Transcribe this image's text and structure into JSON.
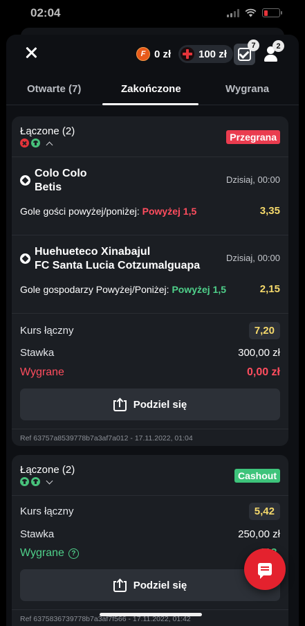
{
  "status_bar": {
    "time": "02:04"
  },
  "header": {
    "coins_value": "0 zł",
    "coin_letter": "F",
    "bonus_value": "100 zł",
    "betslip_count": "7",
    "notifications_count": "2"
  },
  "tabs": [
    {
      "label": "Otwarte (7)"
    },
    {
      "label": "Zakończone"
    },
    {
      "label": "Wygrana"
    }
  ],
  "cards": [
    {
      "title": "Łączone (2)",
      "status": "Przegrana",
      "selections": [
        {
          "home": "Colo Colo",
          "away": "Betis",
          "kickoff": "Dzisiaj, 00:00",
          "market": "Gole gości powyżej/poniżej:",
          "pick": "Powyżej 1,5",
          "odd": "3,35"
        },
        {
          "home": "Huehueteco Xinabajul",
          "away": "FC Santa Lucia Cotzumalguapa",
          "kickoff": "Dzisiaj, 00:00",
          "market": "Gole gospodarzy Powyżej/Poniżej:",
          "pick": "Powyżej 1,5",
          "odd": "2,15"
        }
      ],
      "total_odds_label": "Kurs łączny",
      "total_odds": "7,20",
      "stake_label": "Stawka",
      "stake": "300,00 zł",
      "winnings_label": "Wygrane",
      "winnings": "0,00 zł",
      "share_label": "Podziel się",
      "ref": "Ref 63757a8539778b7a3af7a012 - 17.11.2022, 01:04"
    },
    {
      "title": "Łączone (2)",
      "status": "Cashout",
      "total_odds_label": "Kurs łączny",
      "total_odds": "5,42",
      "stake_label": "Stawka",
      "stake": "250,00 zł",
      "winnings_label": "Wygrane",
      "winnings": "413,",
      "share_label": "Podziel się",
      "ref": "Ref 6375836739778b7a3af7f566 - 17.11.2022, 01:42"
    }
  ],
  "colors": {
    "lost": "#ea3c4f",
    "cashout": "#3ec47b",
    "odds": "#f5d96b",
    "fab": "#e4222e"
  }
}
